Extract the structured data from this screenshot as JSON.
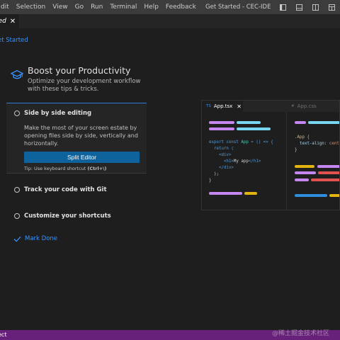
{
  "menu": {
    "items": [
      "dit",
      "Selection",
      "View",
      "Go",
      "Run",
      "Terminal",
      "Help",
      "Feedback"
    ]
  },
  "window": {
    "title": "Get Started - CEC-IDE"
  },
  "tab": {
    "label": "ted",
    "close_glyph": "✕"
  },
  "breadcrumb": {
    "label": "et Started"
  },
  "walkthrough": {
    "title": "Boost your Productivity",
    "subtitle": "Optimize your development workflow with these tips & tricks.",
    "steps": [
      {
        "title": "Side by side editing",
        "description": "Make the most of your screen estate by opening files side by side, vertically and horizontally.",
        "button_label": "Split Editor",
        "tip_prefix": "Tip: Use keyboard shortcut ",
        "tip_shortcut": "(Ctrl+\\)"
      },
      {
        "title": "Track your code with Git"
      },
      {
        "title": "Customize your shortcuts"
      }
    ],
    "mark_done": "Mark Done"
  },
  "preview": {
    "tabs": [
      {
        "ext": "TS",
        "label": "App.tsx",
        "active": true
      },
      {
        "ext": "#",
        "label": "App.css",
        "active": false
      }
    ],
    "tsx_code": [
      [
        "export const ",
        "App",
        " = () => {"
      ],
      [
        "  return ("
      ],
      [
        "    <div>"
      ],
      [
        "      <h1>",
        "My app",
        "</h1>"
      ],
      [
        "    </div>"
      ],
      [
        "  );"
      ],
      [
        "}"
      ]
    ],
    "css_code": [
      [
        ".App {"
      ],
      [
        "  text-align: ",
        "center"
      ],
      [
        "}"
      ]
    ]
  },
  "statusbar": {
    "text": "ect"
  },
  "watermark": "@稀土掘金技术社区",
  "icons": {
    "header": "mortarboard-icon",
    "minimize": "minimize-icon",
    "layout": "layout-icon",
    "maximize": "maximize-icon",
    "close": "close-icon",
    "check": "checkmark-icon"
  },
  "colors": {
    "accent": "#3794ff",
    "button": "#0e639c",
    "statusbar": "#68217a",
    "titlebar": "#3c3c3c",
    "editor_bg": "#1e1e1e"
  }
}
